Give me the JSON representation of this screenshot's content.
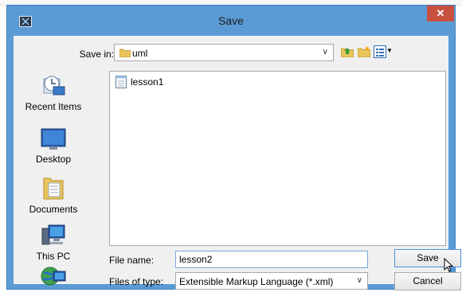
{
  "window": {
    "title": "Save",
    "close_label": "✕"
  },
  "save_in": {
    "label": "Save in:",
    "value": "uml"
  },
  "toolbar": {
    "up_icon": "up-folder-icon",
    "new_folder_icon": "new-folder-icon",
    "view_icon": "view-menu-icon"
  },
  "places": [
    {
      "label": "Recent Items",
      "icon": "recent-items-icon"
    },
    {
      "label": "Desktop",
      "icon": "desktop-icon"
    },
    {
      "label": "Documents",
      "icon": "documents-icon"
    },
    {
      "label": "This PC",
      "icon": "computer-icon"
    },
    {
      "label": "",
      "icon": "network-icon"
    }
  ],
  "files": [
    {
      "name": "lesson1",
      "icon": "file-icon"
    }
  ],
  "file_name": {
    "label": "File name:",
    "value": "lesson2"
  },
  "file_type": {
    "label": "Files of type:",
    "value": "Extensible Markup Language (*.xml)"
  },
  "buttons": {
    "save": "Save",
    "cancel": "Cancel"
  },
  "colors": {
    "title_bar": "#5b9bd5",
    "close": "#c7503f",
    "panel": "#f0f0f0"
  }
}
